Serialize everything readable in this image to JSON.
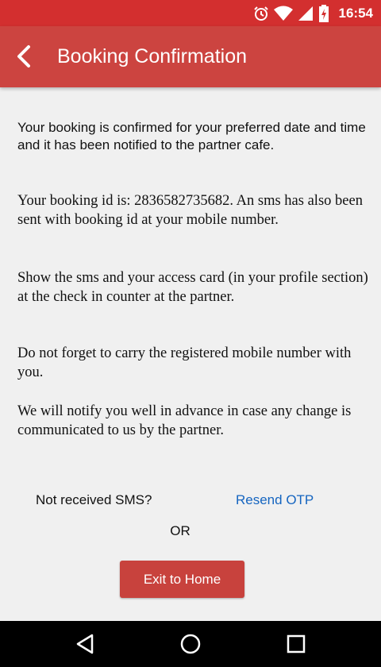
{
  "status_bar": {
    "time": "16:54"
  },
  "app_bar": {
    "title": "Booking Confirmation"
  },
  "content": {
    "paragraph_1": "Your booking is confirmed for your preferred date and time and it has been notified to the partner cafe.",
    "paragraph_2": "Your booking id is: 2836582735682. An sms has also been sent with booking id at your mobile number.",
    "paragraph_3": "Show the sms and your access card (in your profile section) at the check in counter at the partner.",
    "paragraph_4": "Do not forget to carry the registered mobile number with you.",
    "paragraph_5": "We will notify you well in advance in case any change is communicated to us by the partner."
  },
  "actions": {
    "sms_label": "Not received SMS?",
    "resend_label": "Resend OTP",
    "or_label": "OR",
    "exit_label": "Exit to Home"
  },
  "colors": {
    "status_bar": "#d32f2f",
    "app_bar": "#cc4440",
    "link": "#1565c0",
    "button": "#c8423d"
  },
  "icons": [
    "alarm-icon",
    "wifi-icon",
    "signal-icon",
    "battery-charging-icon",
    "back-arrow-icon",
    "nav-back-icon",
    "nav-home-icon",
    "nav-recent-icon"
  ]
}
